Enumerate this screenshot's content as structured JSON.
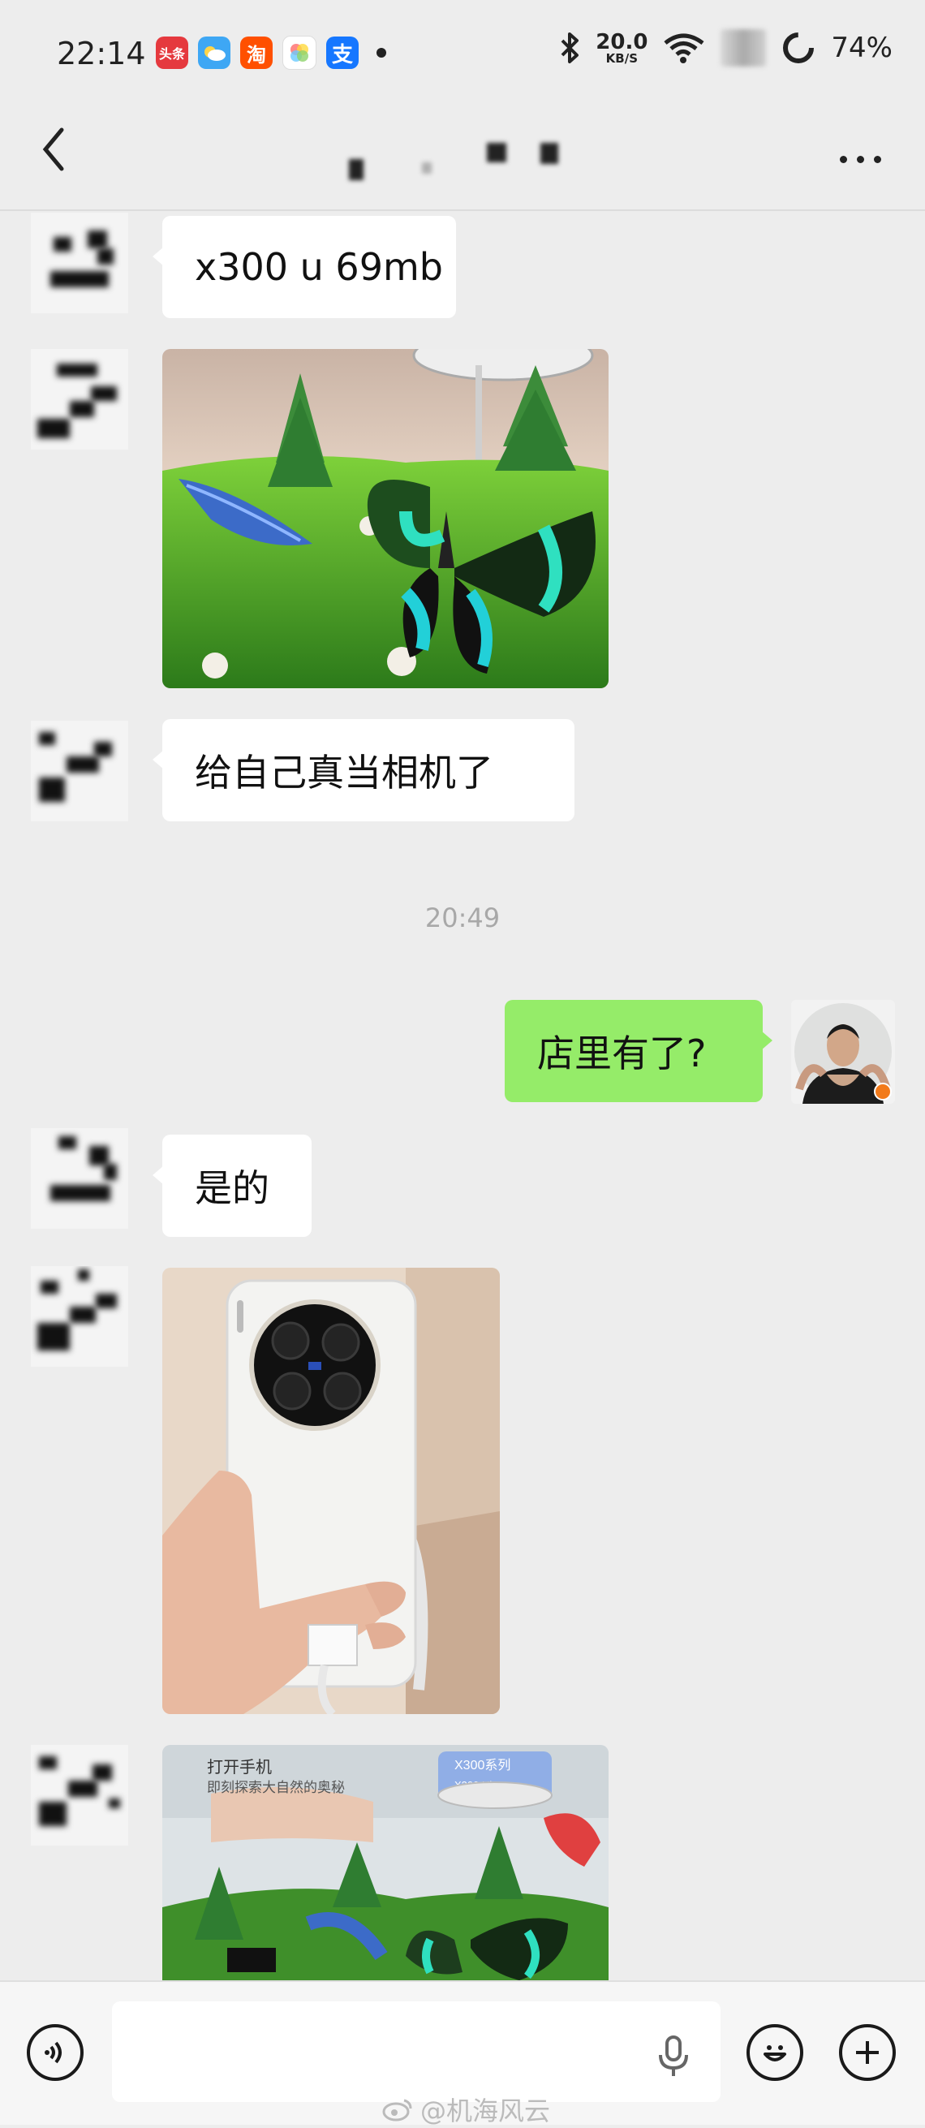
{
  "status_bar": {
    "time": "22:14",
    "net_speed_value": "20.0",
    "net_speed_unit": "KB/S",
    "battery": "74%",
    "app_icons": [
      "头条",
      "weather",
      "淘",
      "photos",
      "支"
    ]
  },
  "header": {
    "title": "",
    "back_icon": "chevron-left-icon",
    "more_icon": "more-horizontal-icon"
  },
  "messages": [
    {
      "side": "left",
      "type": "text",
      "text": "x300 u 69mb"
    },
    {
      "side": "left",
      "type": "image",
      "desc_icon": "photo-icon"
    },
    {
      "side": "left",
      "type": "text",
      "text": "给自己真当相机了"
    },
    {
      "side": "system",
      "type": "timestamp",
      "text": "20:49"
    },
    {
      "side": "right",
      "type": "text",
      "text": "店里有了?"
    },
    {
      "side": "left",
      "type": "text",
      "text": "是的"
    },
    {
      "side": "left",
      "type": "image",
      "desc_icon": "photo-icon"
    },
    {
      "side": "left",
      "type": "image",
      "desc_icon": "photo-icon"
    }
  ],
  "photo_text": {
    "display_line1": "打开手机",
    "display_line2": "即刻探索大自然的奥秘",
    "sign": "X300系列",
    "sign_sub": "X300 Ultra"
  },
  "input_bar": {
    "placeholder": "",
    "voice_icon": "voice-icon",
    "mic_icon": "mic-icon",
    "emoji_icon": "emoji-icon",
    "plus_icon": "plus-icon"
  },
  "watermark": "@机海风云",
  "colors": {
    "background": "#ededed",
    "bubble_self": "#95ec69",
    "bubble_other": "#ffffff",
    "timestamp": "#a8a8a8"
  }
}
